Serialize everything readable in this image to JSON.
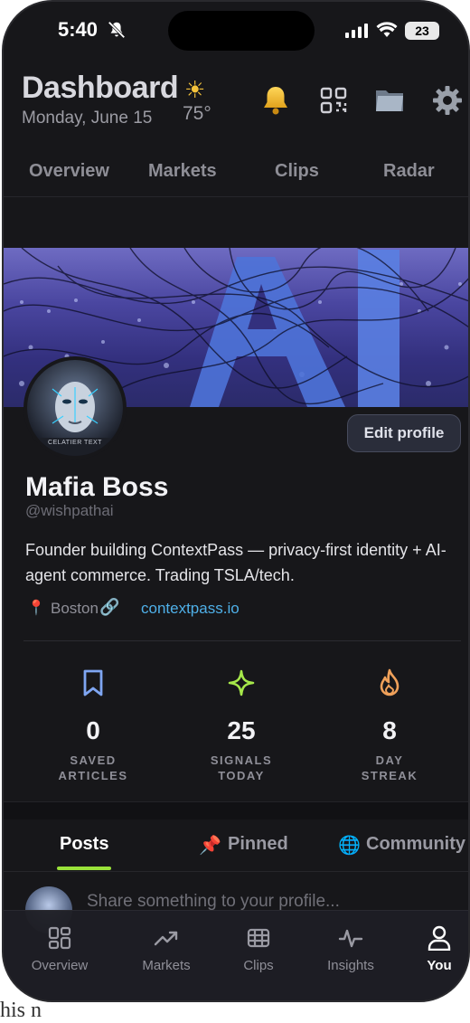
{
  "status_bar": {
    "time": "5:40",
    "battery": "23"
  },
  "header": {
    "title": "Dashboard",
    "weather_icon": "sun-icon",
    "date": "Monday, June 15",
    "temperature": "75°"
  },
  "top_tabs": [
    "Overview",
    "Markets",
    "Clips",
    "Radar"
  ],
  "profile": {
    "edit_label": "Edit profile",
    "avatar_caption": "CELATIER TEXT",
    "name": "Mafia Boss",
    "handle": "@wishpathai",
    "bio": "Founder building ContextPass — privacy-first identity + AI-agent commerce. Trading TSLA/tech.",
    "location": "Boston",
    "link": "contextpass.io"
  },
  "stats": [
    {
      "value": "0",
      "label_line1": "SAVED",
      "label_line2": "ARTICLES",
      "icon": "bookmark-icon"
    },
    {
      "value": "25",
      "label_line1": "SIGNALS",
      "label_line2": "TODAY",
      "icon": "sparkle-icon"
    },
    {
      "value": "8",
      "label_line1": "DAY",
      "label_line2": "STREAK",
      "icon": "flame-icon"
    }
  ],
  "profile_tabs": [
    "Posts",
    "Pinned",
    "Community"
  ],
  "composer": {
    "placeholder": "Share something to your profile..."
  },
  "bottom_nav": [
    "Overview",
    "Markets",
    "Clips",
    "Insights",
    "You"
  ],
  "below_text": "his n",
  "colors": {
    "accent": "#9ae23a",
    "link": "#4fb0e8",
    "background": "#17171a"
  }
}
